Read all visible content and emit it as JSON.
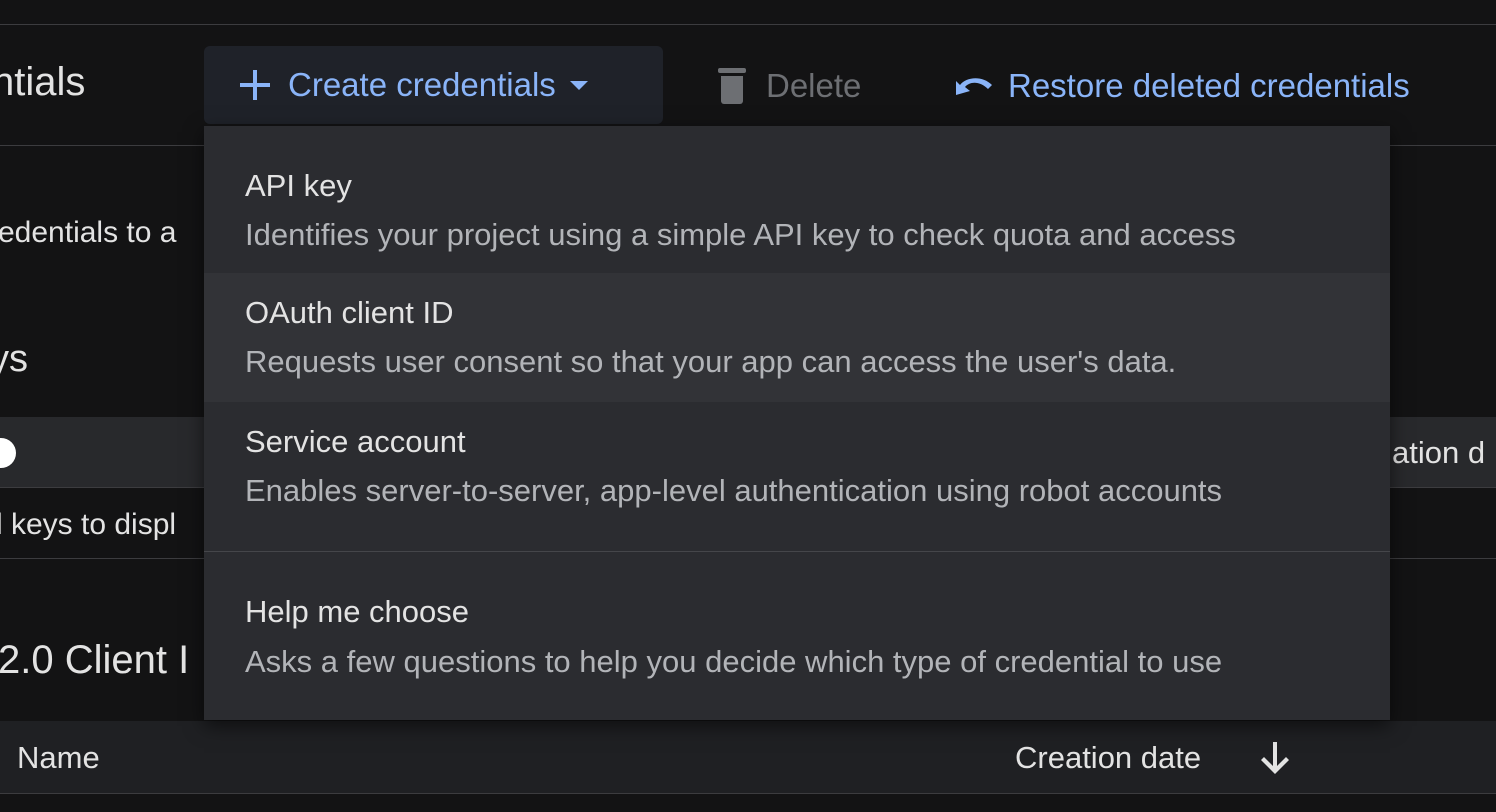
{
  "header": {
    "title": "ntials",
    "create_label": "Create credentials",
    "delete_label": "Delete",
    "restore_label": "Restore deleted credentials"
  },
  "background": {
    "intro_text": "edentials to a",
    "section_heading_partial": "ys",
    "column_partial": "ation d",
    "empty_text": "l keys to displ",
    "oauth_heading_partial": "2.0 Client I",
    "table_header": {
      "name": "Name",
      "creation_date": "Creation date"
    }
  },
  "menu": {
    "items": [
      {
        "title": "API key",
        "description": "Identifies your project using a simple API key to check quota and access"
      },
      {
        "title": "OAuth client ID",
        "description": "Requests user consent so that your app can access the user's data."
      },
      {
        "title": "Service account",
        "description": "Enables server-to-server, app-level authentication using robot accounts"
      },
      {
        "title": "Help me choose",
        "description": "Asks a few questions to help you decide which type of credential to use"
      }
    ]
  },
  "colors": {
    "accent": "#8ab4f8",
    "background": "#131314",
    "menu_background": "#2b2c30",
    "disabled": "#6d6f73"
  },
  "icons": [
    "plus-icon",
    "caret-down-icon",
    "trash-icon",
    "restore-icon",
    "arrow-down-icon"
  ]
}
